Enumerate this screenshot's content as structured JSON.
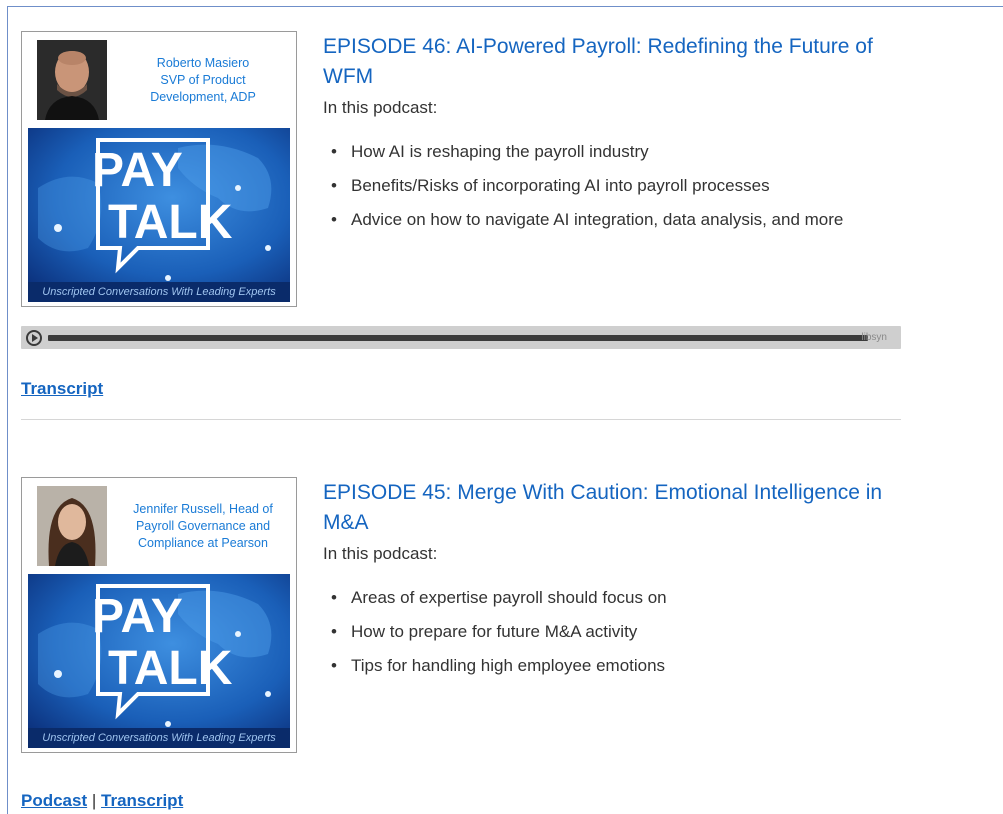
{
  "episodes": [
    {
      "guest": "Roberto Masiero SVP of Product Development, ADP",
      "guest_lines": [
        "Roberto Masiero",
        "SVP of Product",
        "Development, ADP"
      ],
      "banner_line1": "PAY",
      "banner_line2": "TALK",
      "tagline": "Unscripted Conversations With Leading Experts",
      "title": "EPISODE 46: AI-Powered Payroll: Redefining the Future of WFM",
      "intro": "In this podcast:",
      "bullets": [
        "How AI is reshaping the payroll industry",
        "Benefits/Risks of incorporating AI into payroll processes",
        "Advice on how to navigate AI integration, data analysis, and more"
      ]
    },
    {
      "guest_lines": [
        "Jennifer Russell, Head of",
        "Payroll Governance and",
        "Compliance at Pearson"
      ],
      "banner_line1": "PAY",
      "banner_line2": "TALK",
      "tagline": "Unscripted Conversations With Leading Experts",
      "title": "EPISODE 45: Merge With Caution: Emotional Intelligence in M&A",
      "intro": "In this podcast:",
      "bullets": [
        "Areas of expertise payroll should focus on",
        "How to prepare for future M&A activity",
        "Tips for handling high employee emotions"
      ]
    }
  ],
  "player": {
    "brand": "libsyn",
    "progress": 0
  },
  "links": {
    "transcript": "Transcript",
    "podcast": "Podcast",
    "separator": "|"
  },
  "colors": {
    "accent": "#1565c0",
    "guest_text": "#1a7bd6",
    "banner_dark": "#0a2b6a"
  }
}
